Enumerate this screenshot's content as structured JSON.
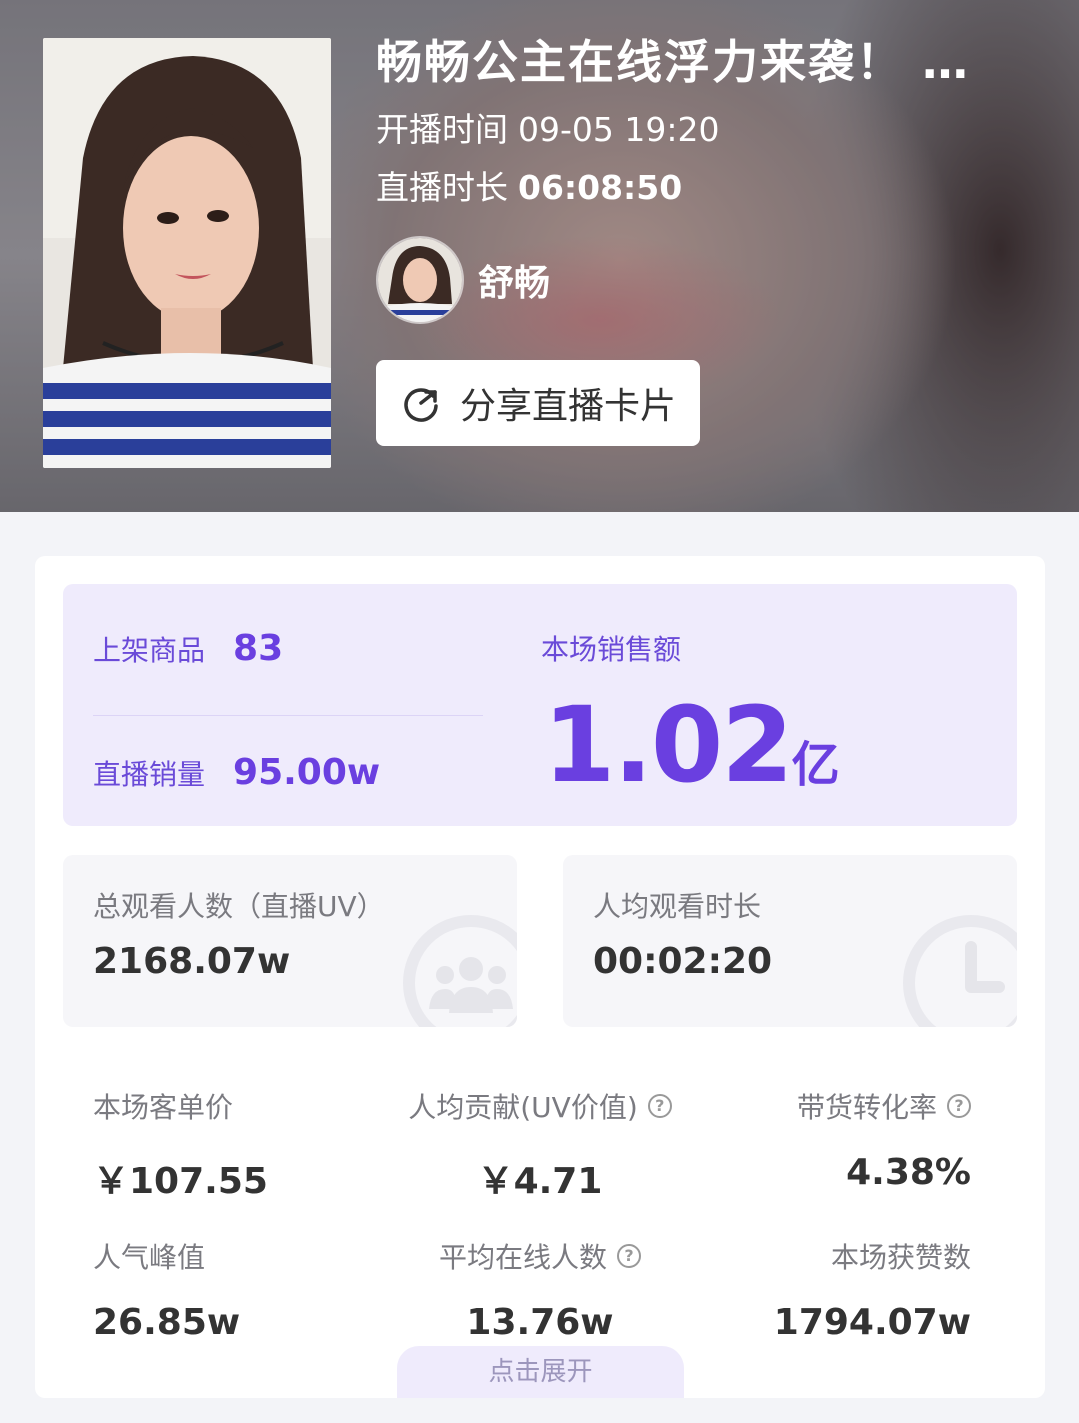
{
  "header": {
    "title": "畅畅公主在线浮力来袭！",
    "start_label": "开播时间",
    "start_time": "09-05 19:20",
    "duration_label": "直播时长",
    "duration": "06:08:50",
    "anchor_name": "舒畅",
    "share_label": "分享直播卡片"
  },
  "sales": {
    "products_label": "上架商品",
    "products_value": "83",
    "volume_label": "直播销量",
    "volume_value": "95.00w",
    "amount_label": "本场销售额",
    "amount_value": "1.02",
    "amount_unit": "亿"
  },
  "stats": {
    "uv_label": "总观看人数（直播UV）",
    "uv_value": "2168.07w",
    "avg_time_label": "人均观看时长",
    "avg_time_value": "00:02:20"
  },
  "metrics": [
    {
      "label": "本场客单价",
      "value": "￥107.55",
      "help": false
    },
    {
      "label": "人均贡献(UV价值)",
      "value": "￥4.71",
      "help": true
    },
    {
      "label": "带货转化率",
      "value": "4.38%",
      "help": true
    },
    {
      "label": "人气峰值",
      "value": "26.85w",
      "help": false
    },
    {
      "label": "平均在线人数",
      "value": "13.76w",
      "help": true
    },
    {
      "label": "本场获赞数",
      "value": "1794.07w",
      "help": false
    }
  ],
  "expand_label": "点击展开",
  "colors": {
    "accent": "#6a3fe0",
    "accent_bg": "#efebfc"
  }
}
